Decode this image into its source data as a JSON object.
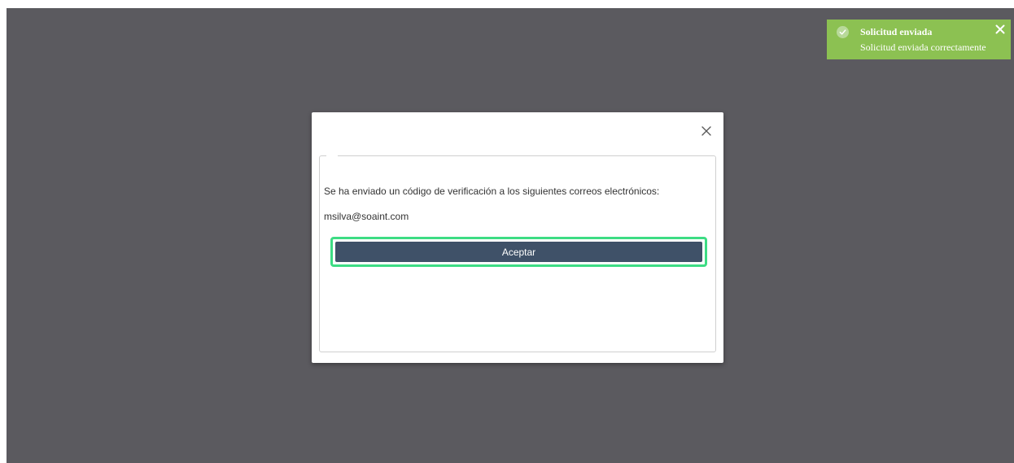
{
  "toast": {
    "title": "Solicitud enviada",
    "detail": "Solicitud enviada correctamente",
    "color": "#8cc152",
    "icon": "check-circle-icon",
    "close_icon": "close-icon"
  },
  "modal": {
    "close_icon": "close-icon",
    "message": "Se ha enviado un código de verificación a los siguientes correos electrónicos:",
    "email": "msilva@soaint.com",
    "accept_label": "Aceptar",
    "accent": "#3f5168",
    "focus_color": "#3ddc84"
  },
  "overlay": {
    "color": "#5b5a5f"
  }
}
